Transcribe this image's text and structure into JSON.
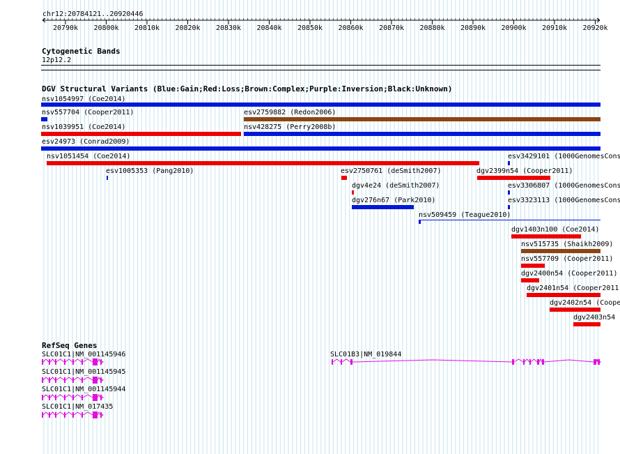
{
  "region": {
    "label": "chr12:20784121..20920446",
    "start": 20784121,
    "end": 20920446
  },
  "ruler": {
    "ticks": [
      "20790k",
      "20800k",
      "20810k",
      "20820k",
      "20830k",
      "20840k",
      "20850k",
      "20860k",
      "20870k",
      "20880k",
      "20890k",
      "20900k",
      "20910k",
      "20920k"
    ]
  },
  "cytoband": {
    "title": "Cytogenetic Bands",
    "band": "12p12.2"
  },
  "dgv": {
    "title": "DGV Structural Variants (Blue:Gain;Red:Loss;Brown:Complex;Purple:Inversion;Black:Unknown)",
    "colors": {
      "gain": "#0018d8",
      "loss": "#ee0000",
      "complex": "#8b4513",
      "inversion": "#800080",
      "unknown": "#000000"
    },
    "features": [
      {
        "label": "nsv1054997 (Coe2014)",
        "type": "gain"
      },
      {
        "label": "nsv557704 (Cooper2011)",
        "type": "gain"
      },
      {
        "label": "esv2759882 (Redon2006)",
        "type": "complex"
      },
      {
        "label": "nsv1039951 (Coe2014)",
        "type": "loss"
      },
      {
        "label": "nsv428275 (Perry2008b)",
        "type": "gain"
      },
      {
        "label": "esv24973 (Conrad2009)",
        "type": "gain"
      },
      {
        "label": "nsv1051454 (Coe2014)",
        "type": "loss"
      },
      {
        "label": "esv3429101 (1000GenomesCons",
        "type": "gain"
      },
      {
        "label": "esv1005353 (Pang2010)",
        "type": "gain"
      },
      {
        "label": "esv2750761 (deSmith2007)",
        "type": "loss"
      },
      {
        "label": "dgv2399n54 (Cooper2011)",
        "type": "loss"
      },
      {
        "label": "dgv4e24 (deSmith2007)",
        "type": "loss"
      },
      {
        "label": "esv3306807 (1000GenomesCons",
        "type": "gain"
      },
      {
        "label": "dgv276n67 (Park2010)",
        "type": "gain"
      },
      {
        "label": "esv3323113 (1000GenomesCons",
        "type": "gain"
      },
      {
        "label": "nsv509459 (Teague2010)",
        "type": "gain"
      },
      {
        "label": "dgv1403n100 (Coe2014)",
        "type": "loss"
      },
      {
        "label": "nsv515735 (Shaikh2009)",
        "type": "complex"
      },
      {
        "label": "nsv557709 (Cooper2011)",
        "type": "loss"
      },
      {
        "label": "dgv2400n54 (Cooper2011)",
        "type": "loss"
      },
      {
        "label": "dgv2401n54 (Cooper2011)",
        "type": "loss"
      },
      {
        "label": "dgv2402n54 (Coope",
        "type": "loss"
      },
      {
        "label": "dgv2403n54",
        "type": "loss"
      }
    ]
  },
  "refseq": {
    "title": "RefSeq Genes",
    "color": "#e010e0",
    "genes": [
      {
        "label": "SLC01C1|NM_001145946"
      },
      {
        "label": "SLC01C1|NM_001145945"
      },
      {
        "label": "SLC01C1|NM_001145944"
      },
      {
        "label": "SLC01C1|NM_017435"
      },
      {
        "label": "SLC01B3|NM_019844"
      }
    ]
  }
}
